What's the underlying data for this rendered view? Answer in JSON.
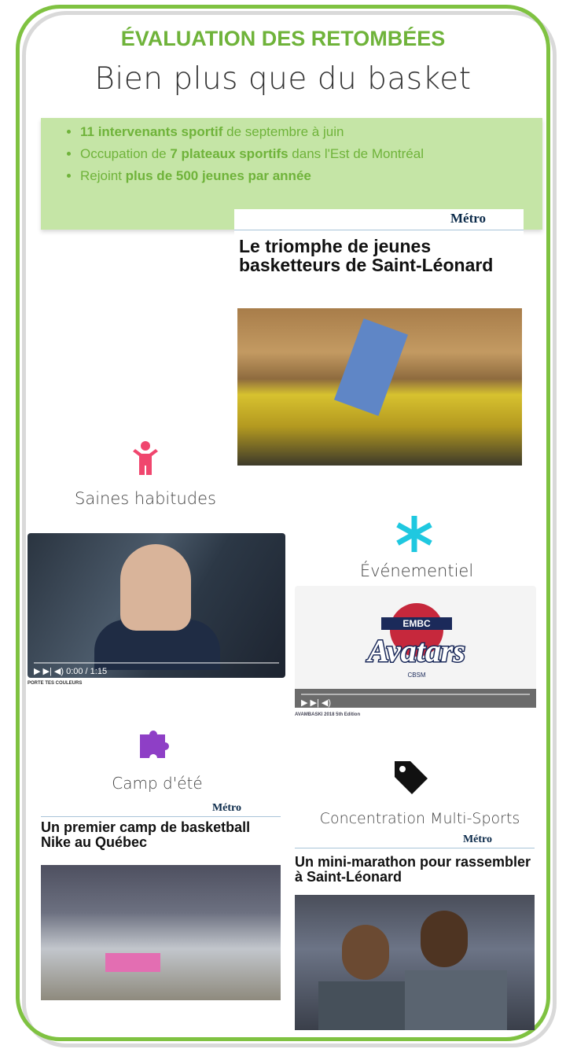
{
  "header": {
    "title": "ÉVALUATION DES RETOMBÉES",
    "subtitle": "Bien plus que du basket"
  },
  "highlights": [
    {
      "bold_lead": "11 intervenants sportif",
      "text": " de septembre à juin"
    },
    {
      "lead": "Occupation de ",
      "bold": "7 plateaux sportifs",
      "tail": " dans l'Est de Montréal"
    },
    {
      "lead": "Rejoint ",
      "bold": "plus de 500 jeunes par année"
    }
  ],
  "articles": {
    "triomphe": {
      "source": "Métro",
      "headline": "Le triomphe de jeunes basketteurs de Saint-Léonard"
    },
    "camp_nike": {
      "source": "Métro",
      "headline": "Un premier camp de basketball Nike au Québec"
    },
    "marathon": {
      "source": "Métro",
      "headline": "Un mini-marathon pour rassembler à Saint-Léonard"
    }
  },
  "pillars": {
    "saines": {
      "label": "Saines habitudes",
      "icon": "child-icon",
      "color": "#f0466e"
    },
    "evenementiel": {
      "label": "Événementiel",
      "icon": "asterisk-icon",
      "color": "#1fc8e0"
    },
    "camp": {
      "label": "Camp d'été",
      "icon": "puzzle-icon",
      "color": "#8e3fc6"
    },
    "concentration": {
      "label": "Concentration Multi-Sports",
      "icon": "tag-icon",
      "color": "#111111"
    }
  },
  "videos": {
    "video1": {
      "caption": "PORTE TES COULEURS",
      "time": "0:00 / 1:15"
    },
    "video2": {
      "caption": "AVAMBASKI 2018 5th Edition",
      "logo_top": "EMBC",
      "logo_main": "Avatars",
      "logo_sub": "CBSM"
    }
  },
  "colors": {
    "accent": "#7fc241",
    "highlight_bg": "#c5e5a6"
  }
}
